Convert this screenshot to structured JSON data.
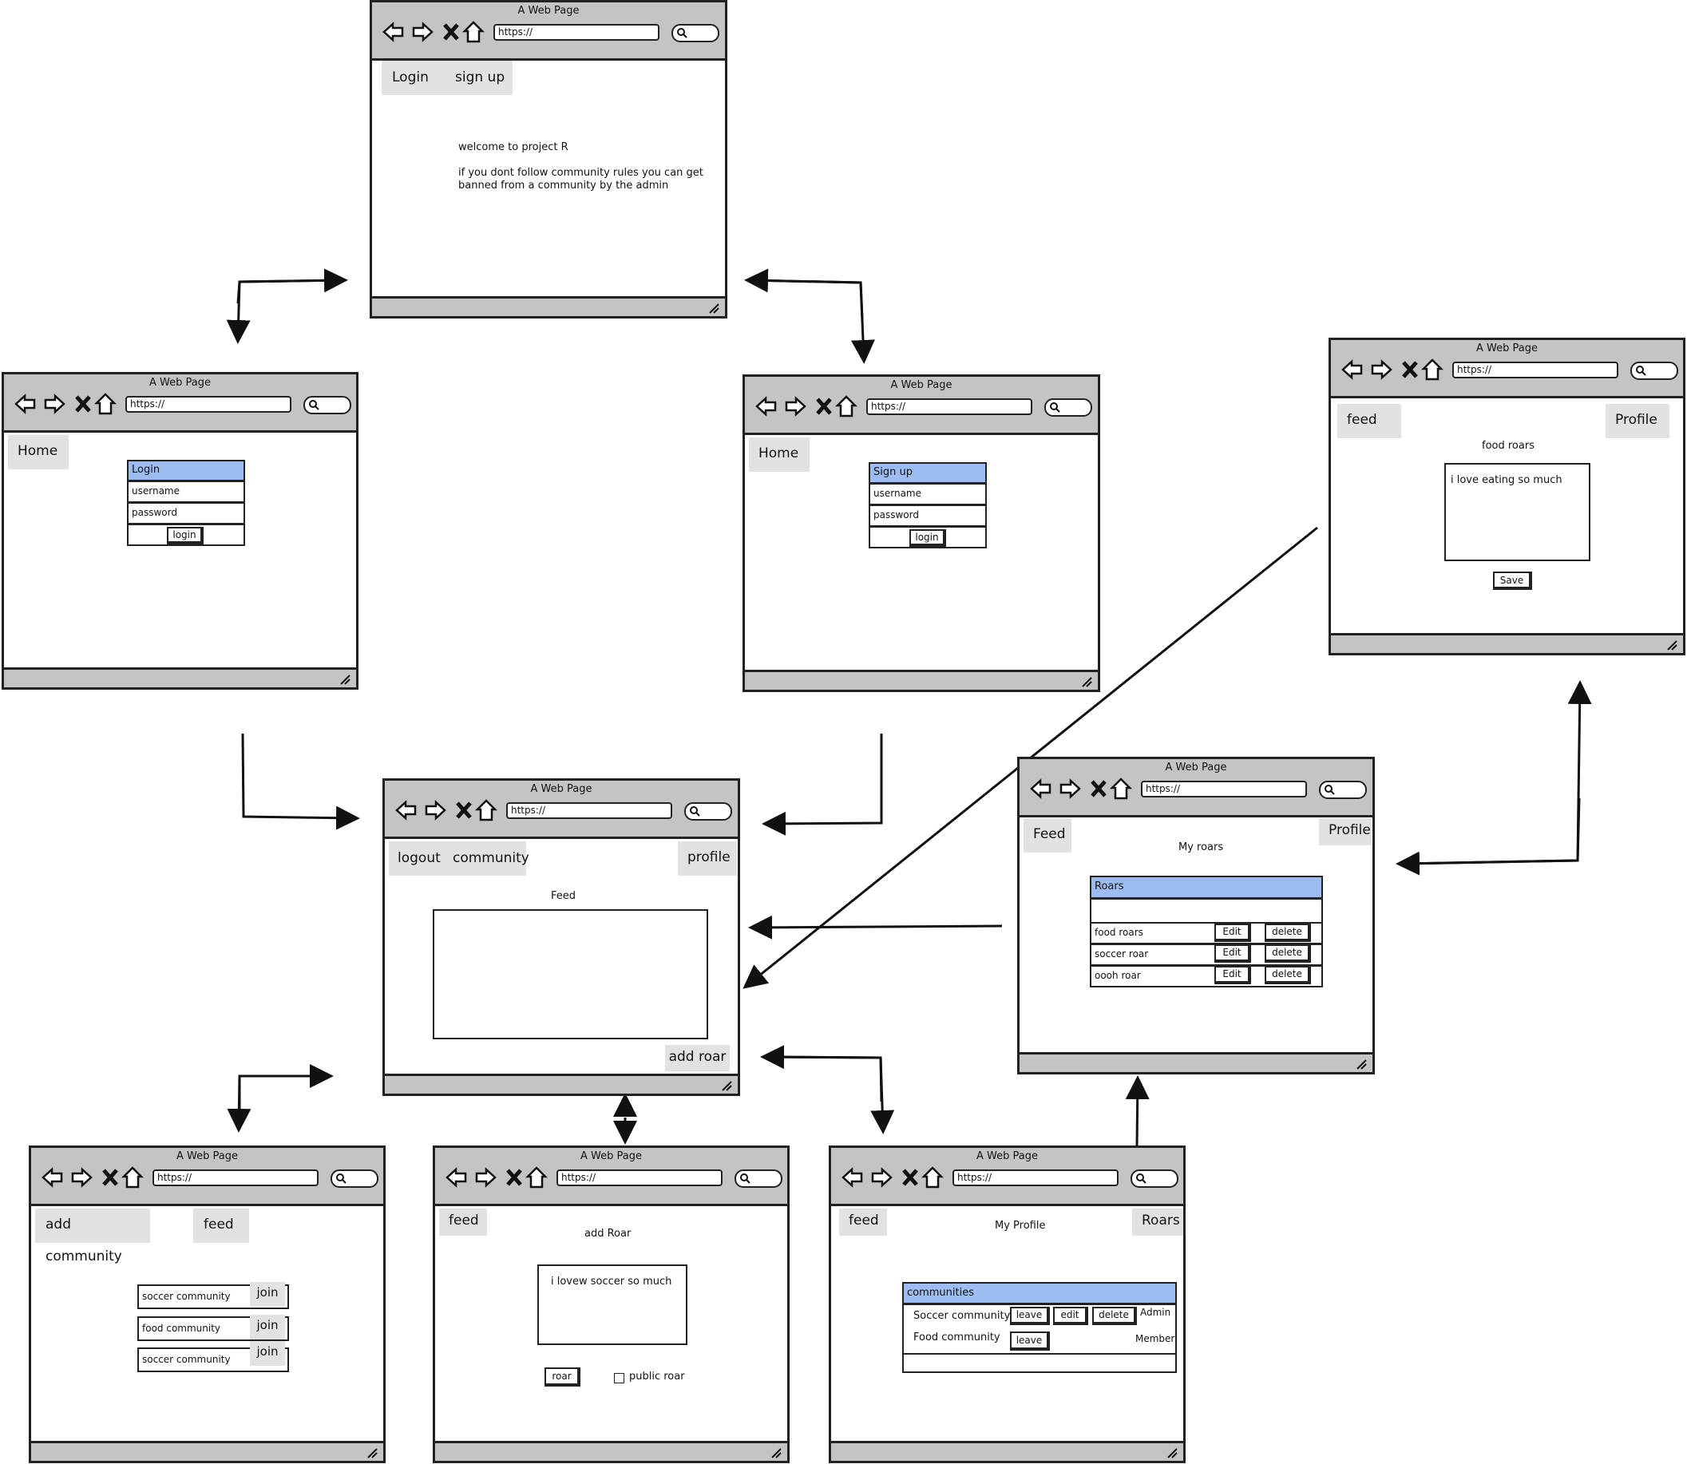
{
  "window_title": "A Web Page",
  "url": "https://",
  "home": {
    "tabs": [
      "Login",
      "sign up"
    ],
    "welcome": "welcome to project R",
    "rules_line1": "if you dont follow community rules you can get",
    "rules_line2": "banned from a community by the admin"
  },
  "login": {
    "home_tab": "Home",
    "form_title": "Login",
    "username": "username",
    "password": "password",
    "button": "login"
  },
  "signup": {
    "home_tab": "Home",
    "form_title": "Sign up",
    "username": "username",
    "password": "password",
    "button": "login"
  },
  "edit_roar": {
    "feed_tab": "feed",
    "profile_tab": "Profile",
    "title": "food roars",
    "content": "i love eating so much",
    "save": "Save"
  },
  "feed": {
    "tab_logout": "logout",
    "tab_community": "community",
    "tab_profile": "profile",
    "title": "Feed",
    "add_roar": "add roar"
  },
  "my_roars": {
    "feed_tab": "Feed",
    "profile_tab": "Profile",
    "title": "My roars",
    "table_header": "Roars",
    "rows": [
      {
        "name": "food roars",
        "edit": "Edit",
        "delete": "delete"
      },
      {
        "name": "soccer roar",
        "edit": "Edit",
        "delete": "delete"
      },
      {
        "name": "oooh roar",
        "edit": "Edit",
        "delete": "delete"
      }
    ]
  },
  "communities": {
    "add_tab": "add community",
    "feed_tab": "feed",
    "rows": [
      {
        "name": "soccer community",
        "join": "join"
      },
      {
        "name": "food community",
        "join": "join"
      },
      {
        "name": "soccer community",
        "join": "join"
      }
    ]
  },
  "add_roar": {
    "feed_tab": "feed",
    "title": "add Roar",
    "content": "i lovew soccer so much",
    "roar_button": "roar",
    "public_label": "public roar"
  },
  "my_profile": {
    "feed_tab": "feed",
    "roars_tab": "Roars",
    "title": "My Profile",
    "table_header": "communities",
    "rows": [
      {
        "name": "Soccer community",
        "leave": "leave",
        "edit": "edit",
        "delete": "delete",
        "role": "Admin"
      },
      {
        "name": "Food community",
        "leave": "leave",
        "role": "Member"
      }
    ]
  }
}
